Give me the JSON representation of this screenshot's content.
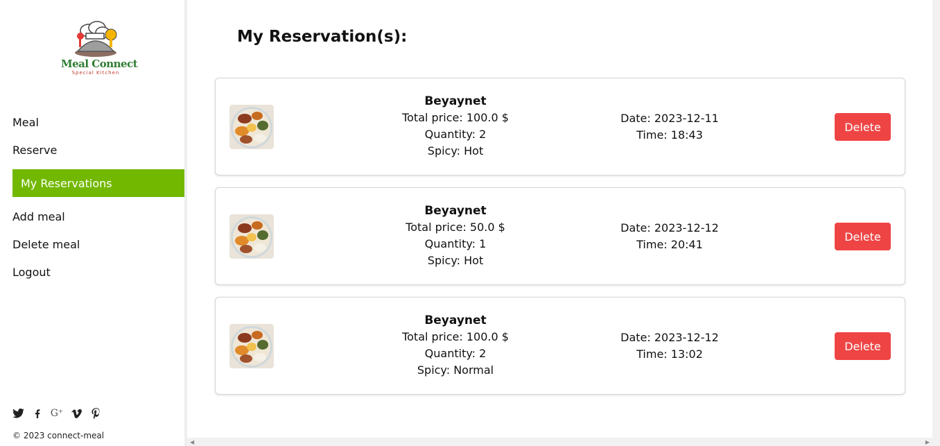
{
  "sidebar": {
    "logo": {
      "title": "Meal Connect",
      "subtitle": "Special Kitchen"
    },
    "nav": [
      {
        "label": "Meal"
      },
      {
        "label": "Reserve"
      },
      {
        "label": "My Reservations",
        "active": true
      },
      {
        "label": "Add meal"
      },
      {
        "label": "Delete meal"
      },
      {
        "label": "Logout"
      }
    ],
    "social_icons": [
      "twitter-icon",
      "facebook-icon",
      "google-plus-icon",
      "vimeo-icon",
      "pinterest-icon"
    ],
    "copyright": "© 2023 connect-meal"
  },
  "main": {
    "title": "My Reservation(s):",
    "reservations": [
      {
        "meal": "Beyaynet",
        "price": "Total price: 100.0 $",
        "quantity": "Quantity: 2",
        "spicy": "Spicy: Hot",
        "date": "Date: 2023-12-11",
        "time": "Time: 18:43",
        "delete_label": "Delete"
      },
      {
        "meal": "Beyaynet",
        "price": "Total price: 50.0 $",
        "quantity": "Quantity: 1",
        "spicy": "Spicy: Hot",
        "date": "Date: 2023-12-12",
        "time": "Time: 20:41",
        "delete_label": "Delete"
      },
      {
        "meal": "Beyaynet",
        "price": "Total price: 100.0 $",
        "quantity": "Quantity: 2",
        "spicy": "Spicy: Normal",
        "date": "Date: 2023-12-12",
        "time": "Time: 13:02",
        "delete_label": "Delete"
      }
    ]
  },
  "colors": {
    "accent": "#72b800",
    "delete": "#ef4444",
    "logo_green": "#2e7d32"
  }
}
